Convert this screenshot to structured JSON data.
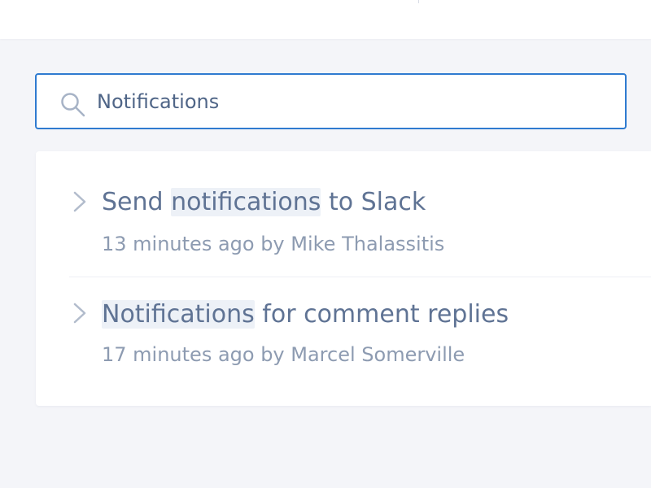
{
  "search": {
    "value": "Notifications"
  },
  "results": [
    {
      "title_prefix": "Send ",
      "title_highlight": "notifications",
      "title_suffix": " to Slack",
      "meta": "13 minutes ago by Mike Thalassitis"
    },
    {
      "title_prefix": "",
      "title_highlight": "Notifications",
      "title_suffix": " for comment replies",
      "meta": "17 minutes ago by Marcel Somerville"
    }
  ],
  "colors": {
    "page_background": "#f4f5f9",
    "search_border": "#2f7bd0",
    "title_text": "#5f7394",
    "meta_text": "#8d9bb1",
    "highlight": "#edf1f7"
  },
  "icons": {
    "search": "search-icon",
    "result_expand": "chevron-right-icon"
  }
}
